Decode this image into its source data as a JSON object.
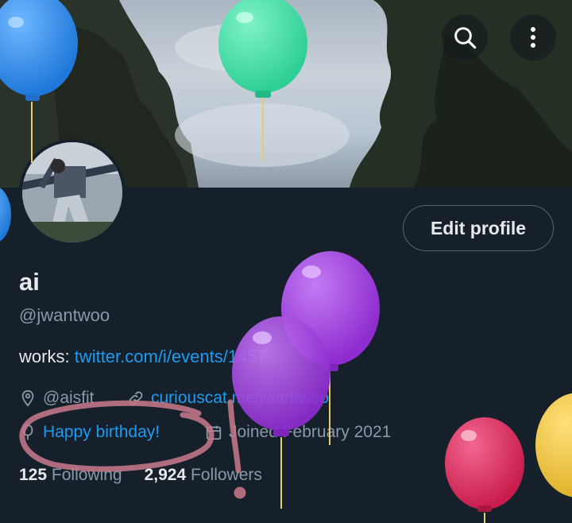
{
  "header": {
    "back_icon": "arrow-left-icon",
    "search_icon": "search-icon",
    "more_icon": "vertical-dots-icon"
  },
  "profile": {
    "edit_label": "Edit profile",
    "name": "ai",
    "handle": "@jwantwoo",
    "bio_prefix": "works:",
    "bio_link": "twitter.com/i/events/1457",
    "location": "@aisfit",
    "website": "curiouscat.me/jwantwoo",
    "birthday": "Happy birthday!",
    "joined": "Joined February 2021",
    "following_count": "125",
    "following_label": "Following",
    "followers_count": "2,924",
    "followers_label": "Followers"
  },
  "colors": {
    "background": "#15202b",
    "link": "#1d9bf0",
    "muted": "#8b98a5",
    "balloon_blue": "#2f8ef0",
    "balloon_green": "#3fe0a8",
    "balloon_purple": "#a43be3",
    "balloon_red": "#e0245e",
    "balloon_yellow": "#f2c53d",
    "annotation": "#c97a8c"
  }
}
